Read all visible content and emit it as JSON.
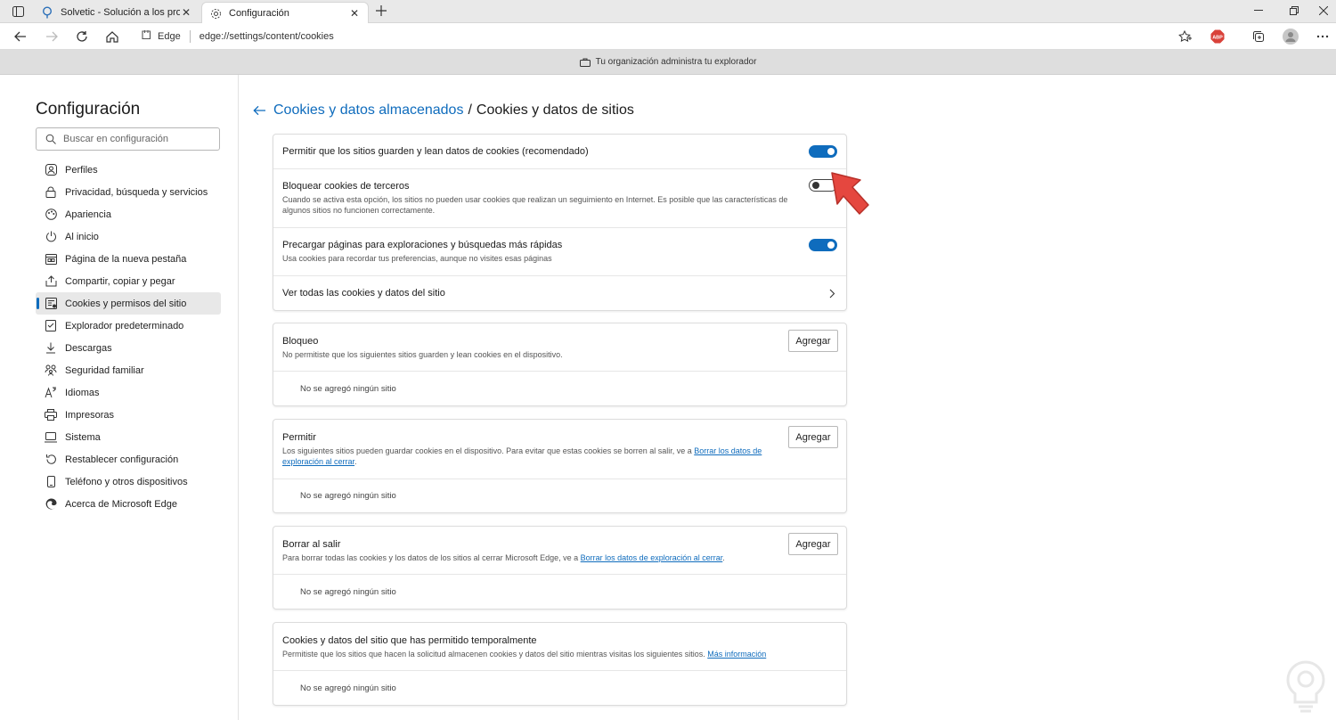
{
  "browser": {
    "tabs": [
      {
        "title": "Solvetic - Solución a los problem",
        "icon": "search-favicon"
      },
      {
        "title": "Configuración",
        "icon": "gear-icon"
      }
    ],
    "address": {
      "site_label": "Edge",
      "url": "edge://settings/content/cookies"
    },
    "toolbar_icons": [
      "favorites-star-icon",
      "adblock-plus-icon",
      "collections-icon",
      "profile-avatar-icon",
      "more-menu-icon"
    ],
    "managed_banner": "Tu organización administra tu explorador"
  },
  "sidebar": {
    "title": "Configuración",
    "search_placeholder": "Buscar en configuración",
    "items": [
      {
        "label": "Perfiles",
        "icon": "profile-icon"
      },
      {
        "label": "Privacidad, búsqueda y servicios",
        "icon": "lock-icon"
      },
      {
        "label": "Apariencia",
        "icon": "appearance-icon"
      },
      {
        "label": "Al inicio",
        "icon": "power-icon"
      },
      {
        "label": "Página de la nueva pestaña",
        "icon": "new-tab-icon"
      },
      {
        "label": "Compartir, copiar y pegar",
        "icon": "share-icon"
      },
      {
        "label": "Cookies y permisos del sitio",
        "icon": "cookies-permissions-icon",
        "active": true
      },
      {
        "label": "Explorador predeterminado",
        "icon": "default-browser-icon"
      },
      {
        "label": "Descargas",
        "icon": "download-icon"
      },
      {
        "label": "Seguridad familiar",
        "icon": "family-icon"
      },
      {
        "label": "Idiomas",
        "icon": "language-icon"
      },
      {
        "label": "Impresoras",
        "icon": "printer-icon"
      },
      {
        "label": "Sistema",
        "icon": "system-icon"
      },
      {
        "label": "Restablecer configuración",
        "icon": "reset-icon"
      },
      {
        "label": "Teléfono y otros dispositivos",
        "icon": "phone-icon"
      },
      {
        "label": "Acerca de Microsoft Edge",
        "icon": "edge-logo-icon"
      }
    ]
  },
  "main": {
    "breadcrumb": {
      "parent": "Cookies y datos almacenados",
      "separator": "/",
      "current": "Cookies y datos de sitios"
    },
    "settings": {
      "allow_cookies": {
        "title": "Permitir que los sitios guarden y lean datos de cookies (recomendado)",
        "enabled": true
      },
      "block_third_party": {
        "title": "Bloquear cookies de terceros",
        "desc": "Cuando se activa esta opción, los sitios no pueden usar cookies que realizan un seguimiento en Internet. Es posible que las características de algunos sitios no funcionen correctamente.",
        "enabled": false
      },
      "preload": {
        "title": "Precargar páginas para exploraciones y búsquedas más rápidas",
        "desc": "Usa cookies para recordar tus preferencias, aunque no visites esas páginas",
        "enabled": true
      },
      "see_all": {
        "title": "Ver todas las cookies y datos del sitio"
      }
    },
    "block": {
      "title": "Bloqueo",
      "desc": "No permitiste que los siguientes sitios guarden y lean cookies en el dispositivo.",
      "add_label": "Agregar",
      "empty": "No se agregó ningún sitio"
    },
    "allow": {
      "title": "Permitir",
      "desc_before": "Los siguientes sitios pueden guardar cookies en el dispositivo. Para evitar que estas cookies se borren al salir, ve a ",
      "desc_link": "Borrar los datos de exploración al cerrar",
      "desc_after": ".",
      "add_label": "Agregar",
      "empty": "No se agregó ningún sitio"
    },
    "clear_on_exit": {
      "title": "Borrar al salir",
      "desc_before": "Para borrar todas las cookies y los datos de los sitios al cerrar Microsoft Edge, ve a ",
      "desc_link": "Borrar los datos de exploración al cerrar",
      "desc_after": ".",
      "add_label": "Agregar",
      "empty": "No se agregó ningún sitio"
    },
    "temporary": {
      "title": "Cookies y datos del sitio que has permitido temporalmente",
      "desc_before": "Permitiste que los sitios que hacen la solicitud almacenen cookies y datos del sitio mientras visitas los siguientes sitios. ",
      "desc_link": "Más información",
      "empty": "No se agregó ningún sitio"
    }
  },
  "colors": {
    "accent": "#0f6cbd",
    "pointer_arrow": "#e5473f"
  }
}
